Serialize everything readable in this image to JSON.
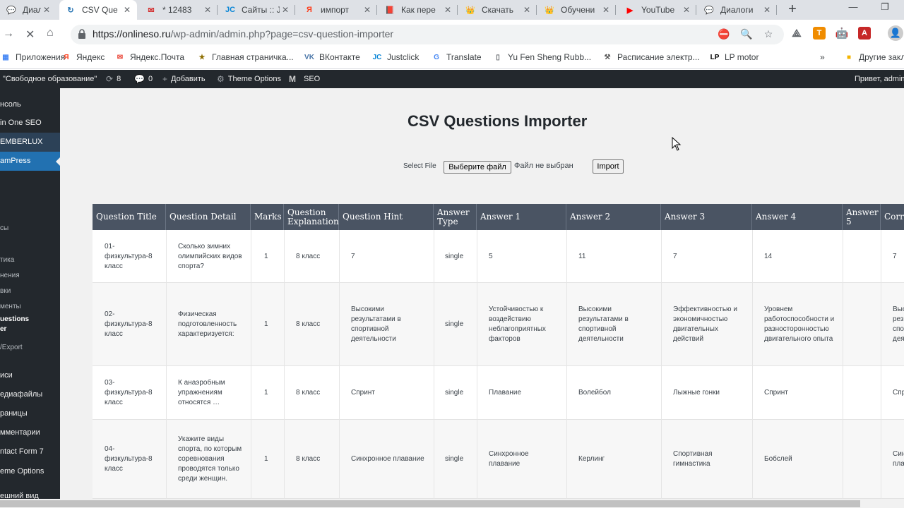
{
  "browser": {
    "tabs": [
      {
        "title": "Диалоги",
        "favicon_color": "#2787f5",
        "glyph": "💬"
      },
      {
        "title": "CSV Que",
        "favicon_color": "#2271b1",
        "glyph": "↻"
      },
      {
        "title": "* 12483",
        "favicon_color": "#d32f2f",
        "glyph": "✉"
      },
      {
        "title": "Сайты :: J",
        "favicon_color": "#0a86d6",
        "glyph": "JC"
      },
      {
        "title": "импорт",
        "favicon_color": "#fc3f1d",
        "glyph": "Я"
      },
      {
        "title": "Как пере",
        "favicon_color": "#e4005a",
        "glyph": "📕"
      },
      {
        "title": "Скачать",
        "favicon_color": "#f4b400",
        "glyph": "👑"
      },
      {
        "title": "Обучени",
        "favicon_color": "#f4b400",
        "glyph": "👑"
      },
      {
        "title": "YouTube",
        "favicon_color": "#ff0000",
        "glyph": "▶"
      },
      {
        "title": "Диалоги",
        "favicon_color": "#2787f5",
        "glyph": "💬"
      }
    ],
    "new_tab": "+",
    "url_host": "https://onlineso.ru",
    "url_path": "/wp-admin/admin.php?page=csv-question-importer",
    "bookmarks": [
      {
        "label": "Приложения",
        "icon": "apps-icon"
      },
      {
        "label": "Яндекс",
        "icon": "yandex-icon"
      },
      {
        "label": "Яндекс.Почта",
        "icon": "mail-icon"
      },
      {
        "label": "Главная страничка...",
        "icon": "home-icon"
      },
      {
        "label": "ВКонтакте",
        "icon": "vk-icon"
      },
      {
        "label": "Justclick",
        "icon": "justclick-icon"
      },
      {
        "label": "Translate",
        "icon": "translate-icon"
      },
      {
        "label": "Yu Fen Sheng Rubb...",
        "icon": "page-icon"
      },
      {
        "label": "Расписание электр...",
        "icon": "train-icon"
      },
      {
        "label": "LP motor",
        "icon": "lp-icon"
      },
      {
        "label": "»",
        "icon": ""
      },
      {
        "label": "Другие закл",
        "icon": "folder-icon"
      }
    ]
  },
  "wpbar": {
    "site": "\"Свободное образование\"",
    "updates": "8",
    "comments": "0",
    "add_new": "Добавить",
    "theme_options": "Theme Options",
    "seo": "SEO",
    "greeting": "Привет, admin"
  },
  "sidebar": {
    "items": [
      {
        "label": "нсоль",
        "style": "big"
      },
      {
        "label": "in One SEO",
        "style": "big"
      },
      {
        "label": "EMBERLUX",
        "style": "hl"
      },
      {
        "label": "amPress",
        "style": "active"
      },
      {
        "label": "сы",
        "style": "sub"
      },
      {
        "label": "тика",
        "style": "sub"
      },
      {
        "label": "нения",
        "style": "sub"
      },
      {
        "label": "вки",
        "style": "sub"
      },
      {
        "label": "менты",
        "style": "sub"
      },
      {
        "label": "uestions",
        "style": "subbold"
      },
      {
        "label": "er",
        "style": "subbold"
      },
      {
        "label": "/Export",
        "style": "sub"
      },
      {
        "label": "иси",
        "style": "big"
      },
      {
        "label": "едиафайлы",
        "style": "big"
      },
      {
        "label": "раницы",
        "style": "big"
      },
      {
        "label": "мментарии",
        "style": "big"
      },
      {
        "label": "ntact Form 7",
        "style": "big"
      },
      {
        "label": "eme Options",
        "style": "big"
      },
      {
        "label": "ешний вид",
        "style": "big"
      }
    ]
  },
  "page": {
    "title": "CSV Questions Importer",
    "select_label": "Select File",
    "choose_file": "Выберите файл",
    "no_file": "Файл не выбран",
    "import_button": "Import"
  },
  "table": {
    "columns": [
      "Question Title",
      "Question Detail",
      "Marks",
      "Question Explanation",
      "Question Hint",
      "Answer Type",
      "Answer 1",
      "Answer 2",
      "Answer 3",
      "Answer 4",
      "Answer 5",
      "Corr"
    ],
    "rows": [
      [
        "01-физкультура-8 класс",
        "Сколько зимних олимпийских видов спорта?",
        "1",
        "8 класс",
        "7",
        "single",
        "5",
        "11",
        "7",
        "14",
        "",
        "7"
      ],
      [
        "02-физкультура-8 класс",
        "Физическая подготовленность характеризуется:",
        "1",
        "8 класс",
        "Высокими результатами в спортивной деятельности",
        "single",
        "Устойчивостью к воздействию неблагоприятных факторов",
        "Высокими результатами в спортивной деятельности",
        "Эффективностью и экономичностью двигательных действий",
        "Уровнем работоспособности и разносторонностью двигательного опыта",
        "",
        "Выс рез спо дея"
      ],
      [
        "03-физкультура-8 класс",
        "К анаэробным упражнениям относятся …",
        "1",
        "8 класс",
        "Спринт",
        "single",
        "Плавание",
        "Волейбол",
        "Лыжные гонки",
        "Спринт",
        "",
        "Спр"
      ],
      [
        "04-физкультура-8 класс",
        "Укажите виды спорта, по которым соревнования проводятся только среди женщин.",
        "1",
        "8 класс",
        "Синхронное плавание",
        "single",
        "Синхронное плавание",
        "Керлинг",
        "Спортивная гимнастика",
        "Бобслей",
        "",
        "Син пла"
      ]
    ]
  }
}
